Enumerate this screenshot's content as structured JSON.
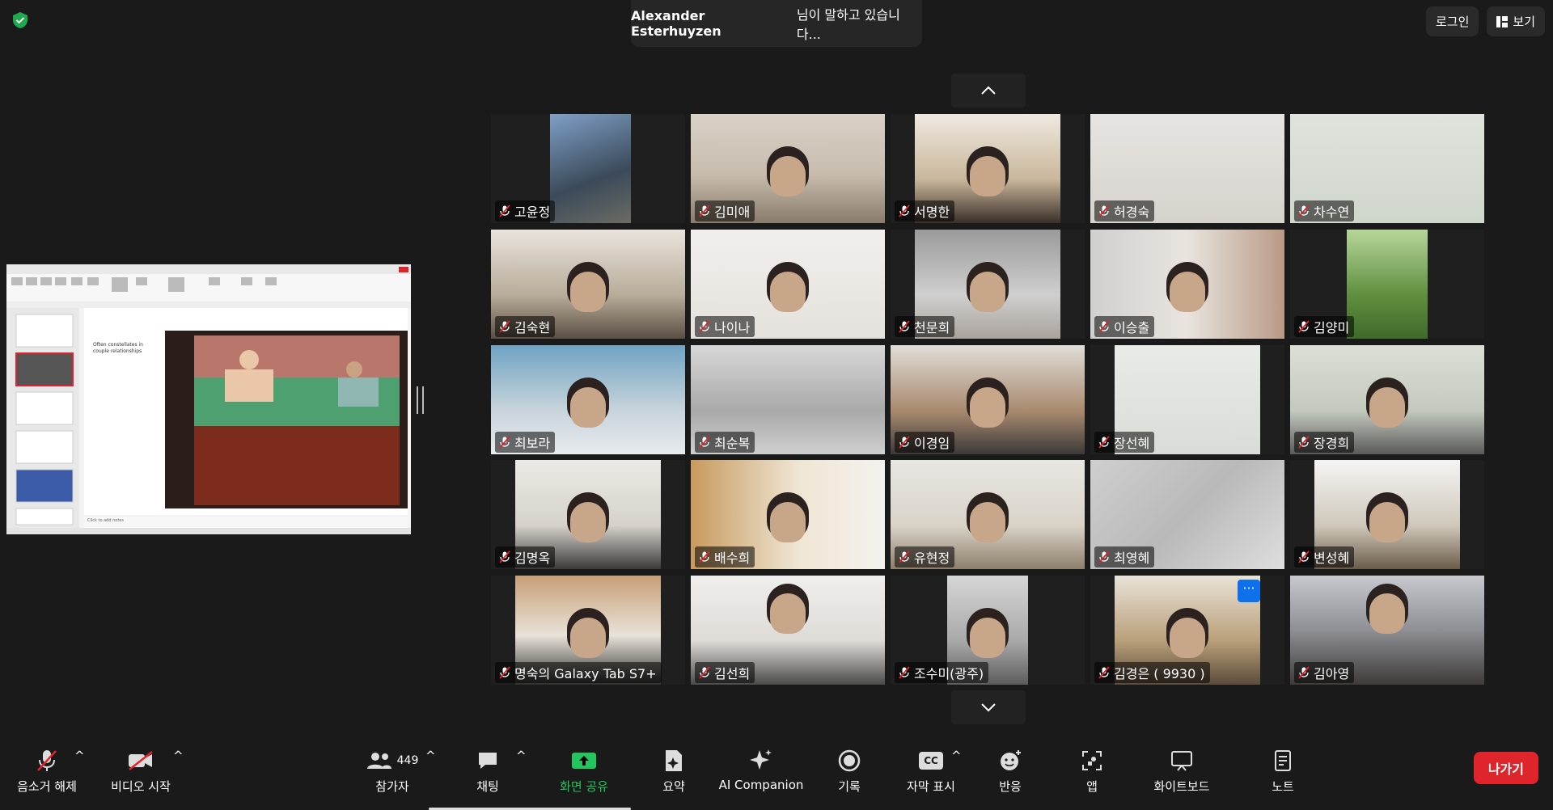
{
  "speaker": {
    "name": "Alexander  Esterhuyzen",
    "suffix": "님이 말하고 있습니다..."
  },
  "top": {
    "login": "로그인",
    "view": "보기"
  },
  "share": {
    "slide_text": "Often constellates in couple relationships",
    "notes_placeholder": "Click to add notes"
  },
  "participants": [
    {
      "name": "고윤정"
    },
    {
      "name": "김미애"
    },
    {
      "name": "서명한"
    },
    {
      "name": "허경숙"
    },
    {
      "name": "차수연"
    },
    {
      "name": "김숙현"
    },
    {
      "name": "나이나"
    },
    {
      "name": "천문희"
    },
    {
      "name": "이승출"
    },
    {
      "name": "김양미"
    },
    {
      "name": "최보라"
    },
    {
      "name": "최순복"
    },
    {
      "name": "이경임"
    },
    {
      "name": "장선혜"
    },
    {
      "name": "장경희"
    },
    {
      "name": "김명옥"
    },
    {
      "name": "배수희"
    },
    {
      "name": "유현정"
    },
    {
      "name": "최영혜"
    },
    {
      "name": "변성혜"
    },
    {
      "name": "명숙의 Galaxy Tab S7+"
    },
    {
      "name": "김선희"
    },
    {
      "name": "조수미(광주)"
    },
    {
      "name": "김경은 ( 9930 )"
    },
    {
      "name": "김아영"
    }
  ],
  "more_label": "···",
  "toolbar": {
    "unmute": "음소거 해제",
    "start_video": "비디오 시작",
    "participants": "참가자",
    "participants_count": "449",
    "chat": "채팅",
    "share_screen": "화면 공유",
    "summary": "요약",
    "ai_companion": "AI Companion",
    "record": "기록",
    "captions": "자막 표시",
    "reactions": "반응",
    "apps": "앱",
    "whiteboard": "화이트보드",
    "notes": "노트",
    "leave": "나가기",
    "cc": "CC"
  },
  "colors": {
    "accent": "#0e71eb",
    "leave": "#e0242b",
    "share_green": "#22c55e",
    "mic_red": "#e0242b"
  }
}
